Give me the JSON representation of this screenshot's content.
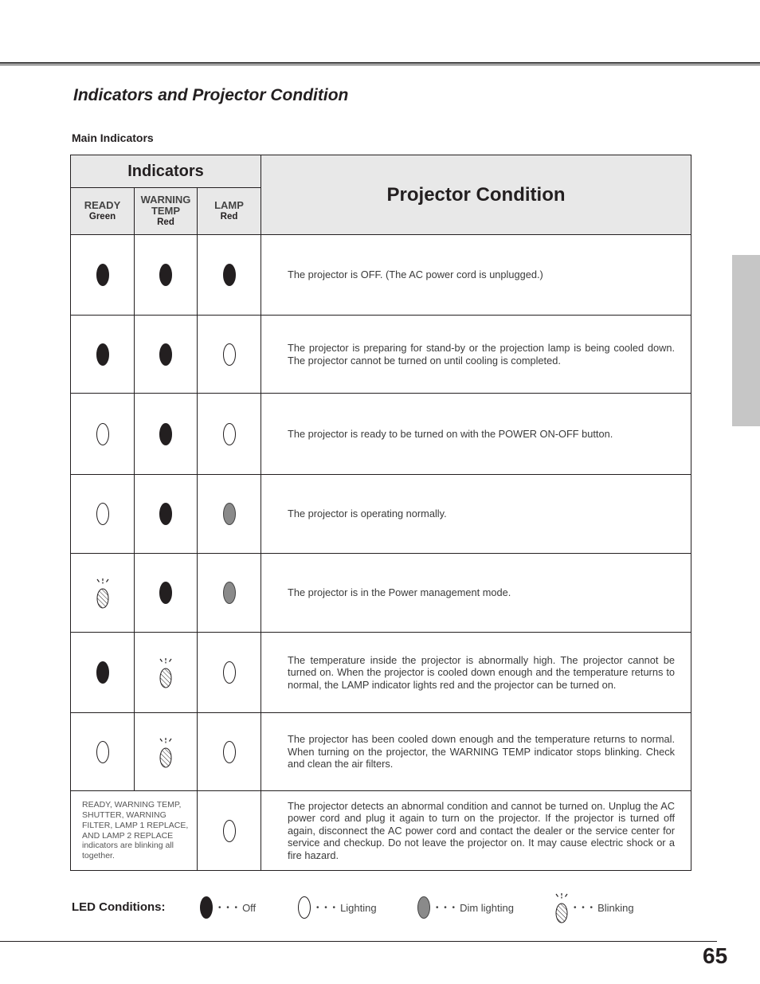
{
  "page": {
    "section_title": "Indicators and Projector Condition",
    "subtitle": "Main Indicators",
    "page_number": "65"
  },
  "table": {
    "header_indicators": "Indicators",
    "header_condition": "Projector Condition",
    "columns": [
      {
        "name": "READY",
        "color": "Green"
      },
      {
        "name": "WARNING TEMP",
        "color": "Red"
      },
      {
        "name": "LAMP",
        "color": "Red"
      }
    ],
    "rows": [
      {
        "ready": "off",
        "warning_temp": "off",
        "lamp": "off",
        "condition": "The projector is OFF. (The AC power cord is unplugged.)"
      },
      {
        "ready": "off",
        "warning_temp": "off",
        "lamp": "lighting",
        "condition": "The projector is preparing for stand-by or the projection lamp is being cooled down. The projector cannot be turned on until cooling is completed."
      },
      {
        "ready": "lighting",
        "warning_temp": "off",
        "lamp": "lighting",
        "condition": "The projector is ready to be turned on with the POWER ON-OFF button."
      },
      {
        "ready": "lighting",
        "warning_temp": "off",
        "lamp": "dim",
        "condition": "The projector is operating normally."
      },
      {
        "ready": "blinking",
        "warning_temp": "off",
        "lamp": "dim",
        "condition": "The projector is in the Power management mode."
      },
      {
        "ready": "off",
        "warning_temp": "blinking",
        "lamp": "lighting",
        "condition": "The temperature inside the projector is abnormally high. The projector cannot be turned on. When  the projector is cooled down enough and the temperature returns to normal, the LAMP indicator lights red and the projector can be turned on."
      },
      {
        "ready": "lighting",
        "warning_temp": "blinking",
        "lamp": "lighting",
        "condition": "The projector has been cooled down enough and the temperature returns to normal. When turning on the projector, the WARNING TEMP indicator stops blinking. Check and clean the air filters."
      }
    ],
    "special_row": {
      "note": "READY, WARNING TEMP, SHUTTER, WARNING FILTER, LAMP 1 REPLACE, AND LAMP 2 REPLACE indicators are blinking all together.",
      "lamp": "lighting",
      "condition": "The projector detects an abnormal condition and cannot be turned on. Unplug the AC power cord and plug it again to turn on the projector.  If the projector is turned off again, disconnect the AC power cord and contact the dealer or the service center for service and checkup. Do not leave the projector on. It may cause electric shock or a fire hazard."
    }
  },
  "legend": {
    "label": "LED Conditions:",
    "separator": "• • •",
    "items": [
      {
        "state": "off",
        "label": "Off",
        "icon": "led-off-icon"
      },
      {
        "state": "lighting",
        "label": "Lighting",
        "icon": "led-lighting-icon"
      },
      {
        "state": "dim",
        "label": "Dim lighting",
        "icon": "led-dim-icon"
      },
      {
        "state": "blinking",
        "label": "Blinking",
        "icon": "led-blinking-icon"
      }
    ]
  },
  "colors": {
    "header_bg": "#e8e8e8",
    "off_fill": "#231f20",
    "dim_fill": "#8a8a8a",
    "side_tab": "#c6c6c6"
  }
}
